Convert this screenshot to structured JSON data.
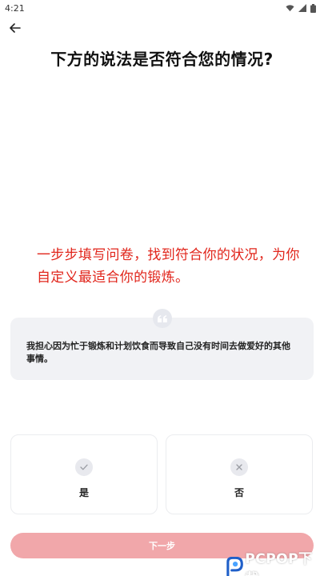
{
  "status_bar": {
    "time": "4:21"
  },
  "header": {
    "title": "下方的说法是否符合您的情况?"
  },
  "overlay": {
    "caption": "一步步填写问卷，找到符合你的状况，为你自定义最适合你的锻炼。"
  },
  "statement": {
    "text": "我担心因为忙于锻炼和计划饮食而导致自己没有时间去做爱好的其他事情。"
  },
  "options": [
    {
      "label": "是",
      "icon": "check-icon"
    },
    {
      "label": "否",
      "icon": "close-icon"
    }
  ],
  "footer": {
    "next_label": "下一步"
  },
  "watermark": {
    "text": "PCPOP下载"
  },
  "colors": {
    "accent": "#f1a7aa",
    "caption": "#e1251b",
    "card_bg": "#f1f2f5"
  }
}
